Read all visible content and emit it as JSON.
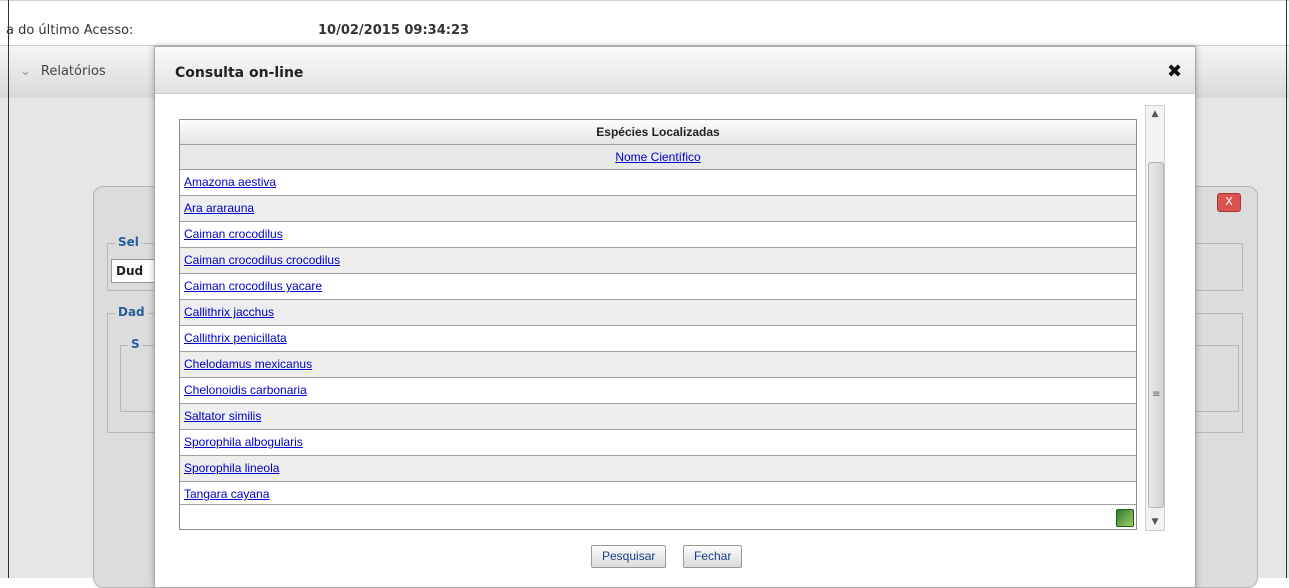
{
  "topbar": {
    "last_access_label": "a do último Acesso:",
    "last_access_value": "10/02/2015 09:34:23"
  },
  "menu": {
    "reports_label": "Relatórios"
  },
  "background": {
    "fieldset1_label": "Sel",
    "input_value": "Dud",
    "fieldset2_label": "Dad",
    "fieldset3_label": "S",
    "close_label": "X"
  },
  "modal": {
    "title": "Consulta on-line",
    "close_label": "✖",
    "grid": {
      "caption": "Espécies Localizadas",
      "column_header": "Nome Científico",
      "rows": [
        "Amazona aestiva",
        "Ara ararauna",
        "Caiman crocodilus",
        "Caiman crocodilus crocodilus",
        "Caiman crocodilus yacare",
        "Callithrix jacchus",
        "Callithrix penicillata",
        "Chelodamus mexicanus",
        "Chelonoidis carbonaria",
        "Saltator similis",
        "Sporophila albogularis",
        "Sporophila lineola",
        "Tangara cayana"
      ],
      "export_icon": "excel-icon"
    },
    "buttons": {
      "search": "Pesquisar",
      "close": "Fechar"
    }
  }
}
